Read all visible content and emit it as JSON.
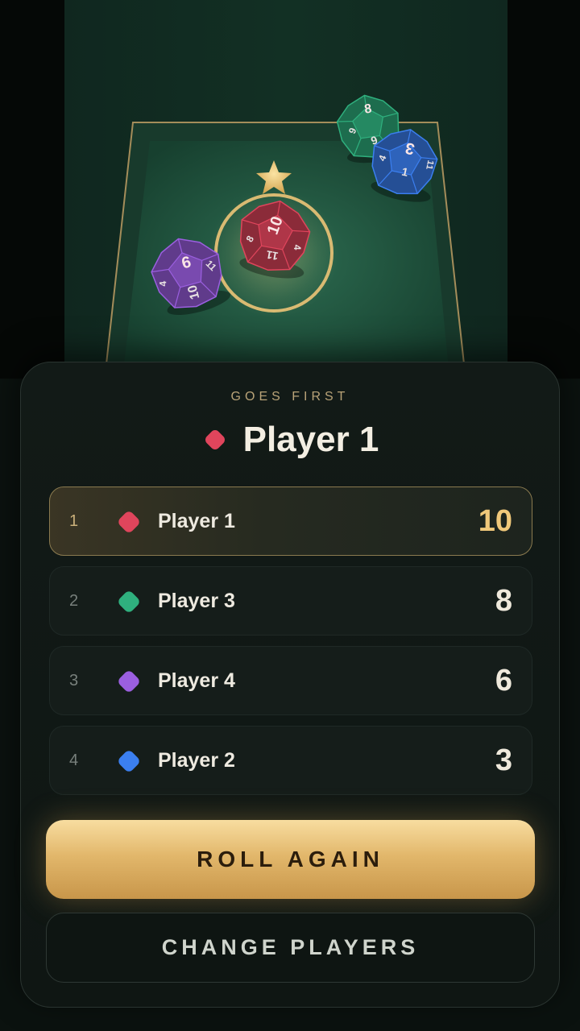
{
  "colors": {
    "red": "#e0455c",
    "green": "#2fb07e",
    "purple": "#9b5fe0",
    "blue": "#3b7ff0",
    "gold": "#e2b76b"
  },
  "result": {
    "label": "GOES FIRST",
    "winner_name": "Player 1",
    "winner_color": "red"
  },
  "dice": [
    {
      "name": "red-die",
      "color": "red",
      "faces": [
        "10",
        "8",
        "11",
        "4"
      ]
    },
    {
      "name": "green-die",
      "color": "green",
      "faces": [
        "8",
        "9",
        "6"
      ]
    },
    {
      "name": "blue-die",
      "color": "blue",
      "faces": [
        "3",
        "4",
        "1",
        "11"
      ]
    },
    {
      "name": "purple-die",
      "color": "purple",
      "faces": [
        "9",
        "4",
        "10",
        "11"
      ]
    }
  ],
  "rankings": [
    {
      "rank": "1",
      "name": "Player 1",
      "score": "10",
      "color": "red"
    },
    {
      "rank": "2",
      "name": "Player 3",
      "score": "8",
      "color": "green"
    },
    {
      "rank": "3",
      "name": "Player 4",
      "score": "6",
      "color": "purple"
    },
    {
      "rank": "4",
      "name": "Player 2",
      "score": "3",
      "color": "blue"
    }
  ],
  "buttons": {
    "roll_again": "ROLL AGAIN",
    "change_players": "CHANGE PLAYERS"
  }
}
